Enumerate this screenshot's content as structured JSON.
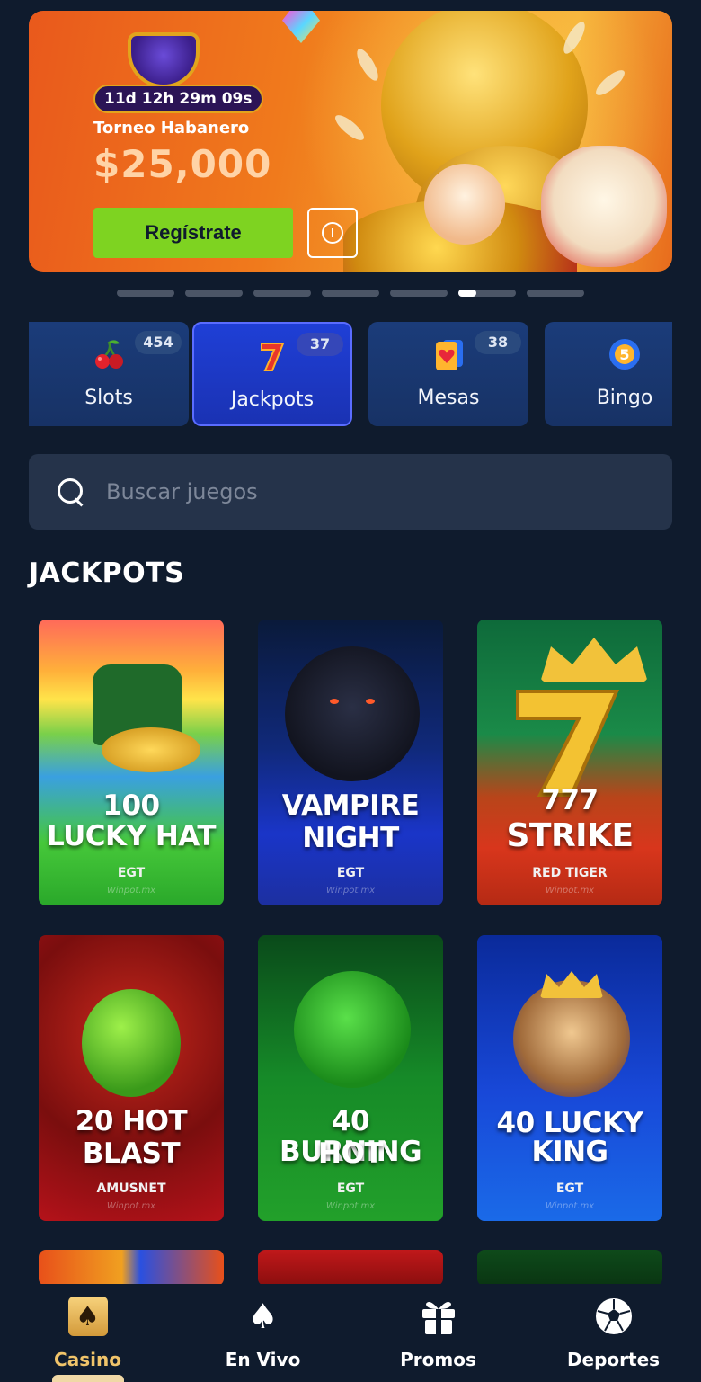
{
  "banner": {
    "timer": "11d 12h 29m 09s",
    "subtitle": "Torneo Habanero",
    "amount": "$25,000",
    "cta_label": "Regístrate"
  },
  "carousel": {
    "total": 7,
    "active_index": 5
  },
  "categories": [
    {
      "label": "Slots",
      "count": "454",
      "icon": "cherries-icon"
    },
    {
      "label": "Jackpots",
      "count": "37",
      "icon": "seven-icon",
      "active": true
    },
    {
      "label": "Mesas",
      "count": "38",
      "icon": "playing-card-heart-icon"
    },
    {
      "label": "Bingo",
      "count": "",
      "icon": "bingo-ball-icon"
    }
  ],
  "search": {
    "placeholder": "Buscar juegos"
  },
  "section": {
    "title": "JACKPOTS"
  },
  "games": [
    {
      "title_line1": "100",
      "title_line2": "LUCKY HAT",
      "provider": "EGT",
      "watermark": "Winpot.mx"
    },
    {
      "title_line1": "VAMPIRE",
      "title_line2": "NIGHT",
      "provider": "EGT",
      "watermark": "Winpot.mx"
    },
    {
      "title_line1": "777",
      "title_line2": "STRIKE",
      "provider": "RED TIGER",
      "watermark": "Winpot.mx"
    },
    {
      "title_line1": "20 HOT",
      "title_line2": "BLAST",
      "provider": "AMUSNET",
      "watermark": "Winpot.mx"
    },
    {
      "title_line1": "40 BURNING",
      "title_line2": "HOT",
      "provider": "EGT",
      "watermark": "Winpot.mx"
    },
    {
      "title_line1": "40 LUCKY",
      "title_line2": "KING",
      "provider": "EGT",
      "watermark": "Winpot.mx"
    }
  ],
  "nav": [
    {
      "label": "Casino",
      "icon": "casino-card-icon",
      "active": true
    },
    {
      "label": "En Vivo",
      "icon": "spade-icon"
    },
    {
      "label": "Promos",
      "icon": "gift-icon"
    },
    {
      "label": "Deportes",
      "icon": "soccer-ball-icon"
    }
  ],
  "colors": {
    "background": "#0f1b2d",
    "cta_green": "#7ed321",
    "active_category": "#1f3fd6",
    "nav_active": "#f0c46a"
  }
}
